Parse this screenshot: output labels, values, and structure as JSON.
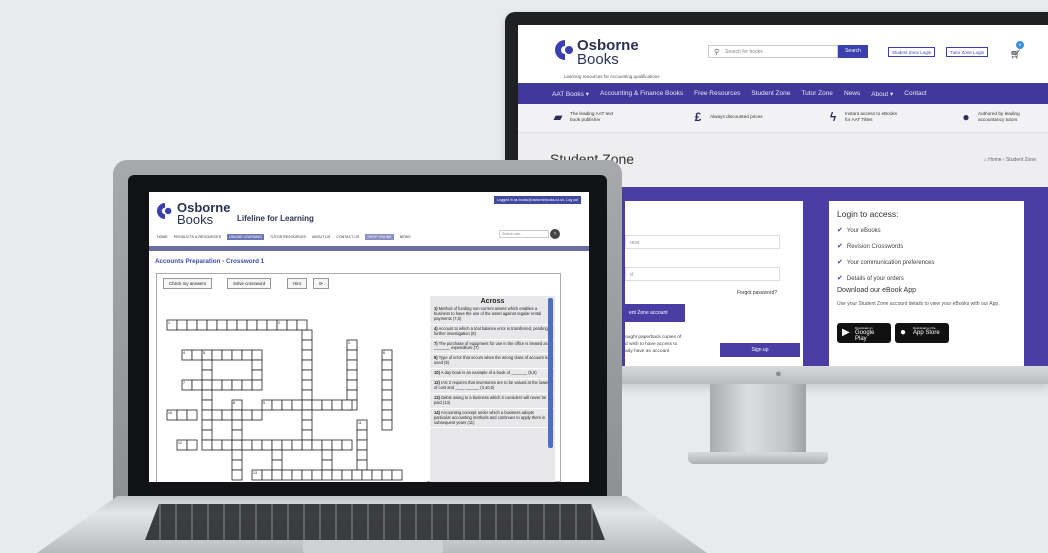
{
  "monitor_site": {
    "logo": {
      "name_bold": "Osborne",
      "name": "Books",
      "tagline": "Learning resources for Accounting qualifications"
    },
    "search": {
      "placeholder": "Search for books",
      "button": "Search"
    },
    "header_buttons": [
      "Student Zone Login",
      "Tutor Zone Login"
    ],
    "cart_count": "0",
    "nav": [
      "AAT Books ▾",
      "Accounting & Finance Books",
      "Free Resources",
      "Student Zone",
      "Tutor Zone",
      "News",
      "About ▾",
      "Contact"
    ],
    "features": [
      {
        "icon": "book-icon",
        "glyph": "▰",
        "text": "The leading AAT text\nbook publisher"
      },
      {
        "icon": "pound-icon",
        "glyph": "£",
        "text": "Always discounted prices"
      },
      {
        "icon": "lightning-icon",
        "glyph": "ϟ",
        "text": "Instant access to eBooks\nfor AAT Titles"
      },
      {
        "icon": "person-icon",
        "glyph": "●",
        "text": "Authored by leading\naccountancy tutors"
      }
    ],
    "page_title": "Student Zone",
    "breadcrumb": "⌂ Home  ›  Student Zone",
    "left_card": {
      "email_placeholder": "ress",
      "password_placeholder": "d",
      "forgot": "Forgot password?",
      "login_button": "ent Zone account",
      "para": "ought paperback copies of\nd wish to have access to\nady have an account",
      "signup_button": "Sign up"
    },
    "login_card": {
      "heading": "Login to access:",
      "items": [
        "Your eBooks",
        "Revision Crosswords",
        "Your communication preferences",
        "Details of your orders"
      ],
      "app_heading": "Download our eBook App",
      "app_text": "Use your Student Zone account details to view your eBooks with our App.",
      "google_small": "Download on",
      "google": "Google Play",
      "apple_small": "Download on the",
      "apple": "App Store"
    }
  },
  "laptop_site": {
    "logo": {
      "name_bold": "Osborne",
      "name": "Books"
    },
    "lifeline": "Lifeline for Learning",
    "logged_in": "Logged in as books@osbornebooks.co.uk. Log out",
    "nav": [
      "HOME",
      "PRODUCTS & RESOURCES",
      "ONLINE LEARNING",
      "TUTOR RESOURCES",
      "ABOUT US",
      "CONTACT US",
      "SHOP ONLINE",
      "NEWS"
    ],
    "nav_active": "ONLINE LEARNING",
    "search_placeholder": "Search site...",
    "page_title": "Accounts Preparation - Crossword 1",
    "toolbar": [
      "Check my answers",
      "Solve crossword",
      "Hint",
      "⟳"
    ],
    "clues_heading": "Across",
    "clues": [
      {
        "num": "1)",
        "text": "Method of funding non-current assets which enables a business to have the use of the asset against regular rental payments (7,5)"
      },
      {
        "num": "4)",
        "text": "Account to which a trial balance error is transferred, pending further investigation (8)"
      },
      {
        "num": "7)",
        "text": "The purchase of equipment for use in the office is treated as _______ expenditure (7)"
      },
      {
        "num": "9)",
        "text": "Type of error that occurs when the wrong class of account is used (9)"
      },
      {
        "num": "10)",
        "text": "A day book is an example of a book of _______ (5,5)"
      },
      {
        "num": "12)",
        "text": "IAS 2 requires that inventories are to be valued at the lower of cost and ____ ______ (3,10,5)"
      },
      {
        "num": "13)",
        "text": "Debts owing to a business which it considers will never be paid (13)"
      },
      {
        "num": "14)",
        "text": "Accounting concept under which a business adopts particular accounting methods and continues to apply them in subsequent years (11)"
      }
    ],
    "grid_numbers": [
      "1",
      "2",
      "3",
      "4",
      "5",
      "6",
      "7",
      "8",
      "9",
      "10",
      "11",
      "12",
      "13"
    ]
  }
}
